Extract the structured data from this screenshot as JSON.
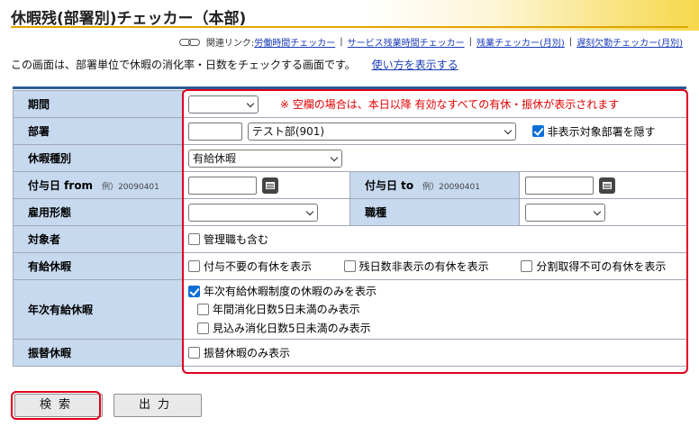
{
  "header": {
    "title": "休暇残(部署別)チェッカー（本部)",
    "related_prefix": "関連リンク:",
    "related_links": [
      "労働時間チェッカー",
      "サービス残業時間チェッカー",
      "残業チェッカー(月別)",
      "遅刻欠勤チェッカー(月別)"
    ]
  },
  "description": {
    "text": "この画面は、部署単位で休暇の消化率・日数をチェックする画面です。",
    "howto_link": "使い方を表示する"
  },
  "form": {
    "period": {
      "label": "期間",
      "value": "",
      "note": "※ 空欄の場合は、本日以降 有効なすべての有休・振休が表示されます"
    },
    "department": {
      "label": "部署",
      "code": "",
      "selected": "テスト部(901)",
      "hide_label": "非表示対象部署を隠す",
      "hide_checked": true
    },
    "leave_type": {
      "label": "休暇種別",
      "selected": "有給休暇"
    },
    "grant_from": {
      "label": "付与日 from",
      "example": "例）20090401",
      "value": ""
    },
    "grant_to": {
      "label": "付与日 to",
      "example": "例）20090401",
      "value": ""
    },
    "employment": {
      "label": "雇用形態",
      "value": ""
    },
    "job_type": {
      "label": "職種",
      "value": ""
    },
    "target": {
      "label": "対象者",
      "include_managers": "管理職も含む"
    },
    "paid_leave": {
      "label": "有給休暇",
      "options": [
        "付与不要の有休を表示",
        "残日数非表示の有休を表示",
        "分割取得不可の有休を表示"
      ]
    },
    "annual_paid": {
      "label": "年次有給休暇",
      "main_option": "年次有給休暇制度の休暇のみを表示",
      "main_checked": true,
      "sub_options": [
        "年間消化日数5日未満のみ表示",
        "見込み消化日数5日未満のみ表示"
      ]
    },
    "substitute": {
      "label": "振替休暇",
      "option": "振替休暇のみ表示"
    }
  },
  "buttons": {
    "search": "検索",
    "output": "出力"
  },
  "colors": {
    "label_bg": "#c7d9ef",
    "highlight": "#e1001e",
    "link": "#1a3bb8",
    "title_accent": "#e2a400"
  }
}
